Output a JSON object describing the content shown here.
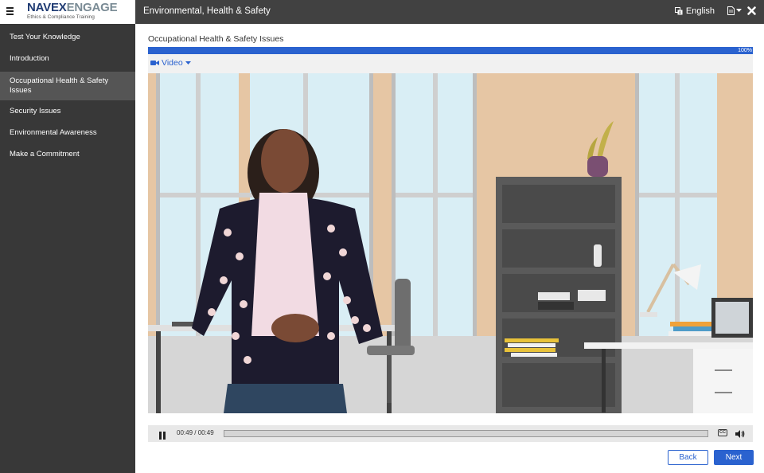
{
  "header": {
    "logo_primary": "NAVEX",
    "logo_secondary": "ENGAGE",
    "logo_tagline": "Ethics & Compliance Training",
    "course_title": "Environmental, Health & Safety",
    "language": "English",
    "menu_icon": "hamburger-icon",
    "language_icon": "translate-icon",
    "document_icon": "document-icon",
    "close_icon": "close-icon"
  },
  "sidebar": {
    "items": [
      {
        "label": "Test Your Knowledge",
        "active": false
      },
      {
        "label": "Introduction",
        "active": false
      },
      {
        "label": "Occupational Health & Safety Issues",
        "active": true
      },
      {
        "label": "Security Issues",
        "active": false
      },
      {
        "label": "Environmental Awareness",
        "active": false
      },
      {
        "label": "Make a Commitment",
        "active": false
      }
    ]
  },
  "main": {
    "section_title": "Occupational Health & Safety Issues",
    "progress_percent": 100,
    "progress_label": "100%",
    "media_tab": "Video",
    "media_tab_icon": "video-camera-icon"
  },
  "player": {
    "time": "00:49 / 00:49",
    "elapsed_fraction": 1.0,
    "pause_icon": "pause-icon",
    "cc_label": "CC",
    "volume_icon": "volume-icon"
  },
  "nav": {
    "back_label": "Back",
    "next_label": "Next"
  },
  "colors": {
    "accent": "#2a62cf",
    "topbar": "#414141",
    "sidebar": "#383838",
    "sidebar_active": "#555555"
  }
}
